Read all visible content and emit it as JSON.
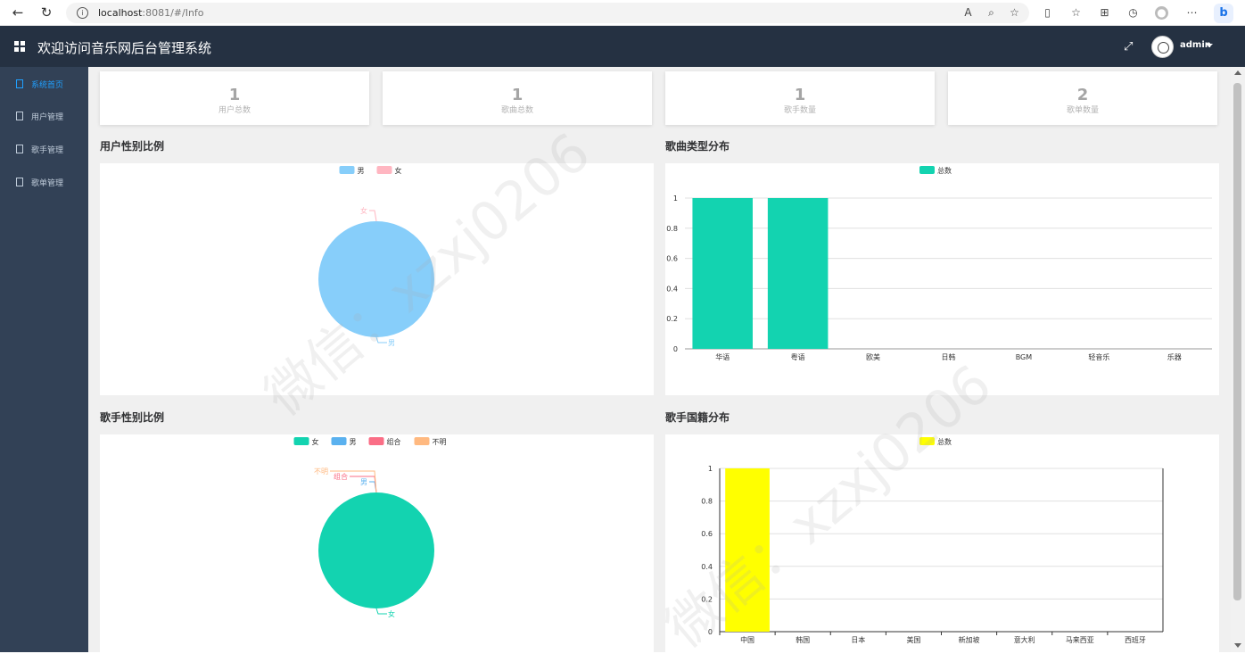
{
  "browser": {
    "url_host": "localhost",
    "url_rest": ":8081/#/Info",
    "icons": [
      "back-icon",
      "refresh-icon",
      "info-icon",
      "read-aloud-icon",
      "zoom-icon",
      "favorite-add-icon",
      "split-screen-icon",
      "favorites-icon",
      "collections-icon",
      "history-icon",
      "profile-icon",
      "more-icon",
      "bing-icon"
    ],
    "bing_label": "b"
  },
  "header": {
    "title": "欢迎访问音乐网后台管理系统",
    "user": "admin"
  },
  "sidebar": {
    "items": [
      {
        "label": "系统首页",
        "active": true
      },
      {
        "label": "用户管理",
        "active": false
      },
      {
        "label": "歌手管理",
        "active": false
      },
      {
        "label": "歌单管理",
        "active": false
      }
    ]
  },
  "stats": [
    {
      "value": "1",
      "label": "用户总数"
    },
    {
      "value": "1",
      "label": "歌曲总数"
    },
    {
      "value": "1",
      "label": "歌手数量"
    },
    {
      "value": "2",
      "label": "歌单数量"
    }
  ],
  "sections": {
    "user_gender": "用户性别比例",
    "song_type": "歌曲类型分布",
    "singer_gender": "歌手性别比例",
    "singer_country": "歌手国籍分布"
  },
  "watermark": "微信：xzxj0206",
  "colors": {
    "header_bg": "#253142",
    "sidebar_bg": "#324156",
    "active": "#20a0ff",
    "teal": "#13d3b0",
    "blue": "#87cefa",
    "pink": "#ffb6c1",
    "yellow": "#ffff00"
  },
  "chart_data": [
    {
      "type": "pie",
      "legend": [
        "男",
        "女"
      ],
      "labels": [
        "男",
        "女"
      ],
      "values": [
        1,
        0
      ],
      "colors": [
        "#87cefa",
        "#ffb6c1"
      ]
    },
    {
      "type": "bar",
      "legend": [
        "总数"
      ],
      "categories": [
        "华语",
        "粤语",
        "欧美",
        "日韩",
        "BGM",
        "轻音乐",
        "乐器"
      ],
      "series": [
        {
          "name": "总数",
          "values": [
            1,
            1,
            0,
            0,
            0,
            0,
            0
          ]
        }
      ],
      "yticks": [
        "0",
        "0.2",
        "0.4",
        "0.6",
        "0.8",
        "1"
      ],
      "ylim": [
        0,
        1
      ],
      "color": "#13d3b0"
    },
    {
      "type": "pie",
      "legend": [
        "女",
        "男",
        "组合",
        "不明"
      ],
      "labels": [
        "女",
        "男",
        "组合",
        "不明"
      ],
      "values": [
        1,
        0,
        0,
        0
      ],
      "colors": [
        "#13d3b0",
        "#5ab1ef",
        "#fa6e86",
        "#ffb980"
      ]
    },
    {
      "type": "bar",
      "legend": [
        "总数"
      ],
      "categories": [
        "中国",
        "韩国",
        "日本",
        "美国",
        "新加坡",
        "意大利",
        "马来西亚",
        "西班牙"
      ],
      "series": [
        {
          "name": "总数",
          "values": [
            1,
            0,
            0,
            0,
            0,
            0,
            0,
            0
          ]
        }
      ],
      "yticks": [
        "0",
        "0.2",
        "0.4",
        "0.6",
        "0.8",
        "1"
      ],
      "ylim": [
        0,
        1
      ],
      "color": "#ffff00"
    }
  ]
}
